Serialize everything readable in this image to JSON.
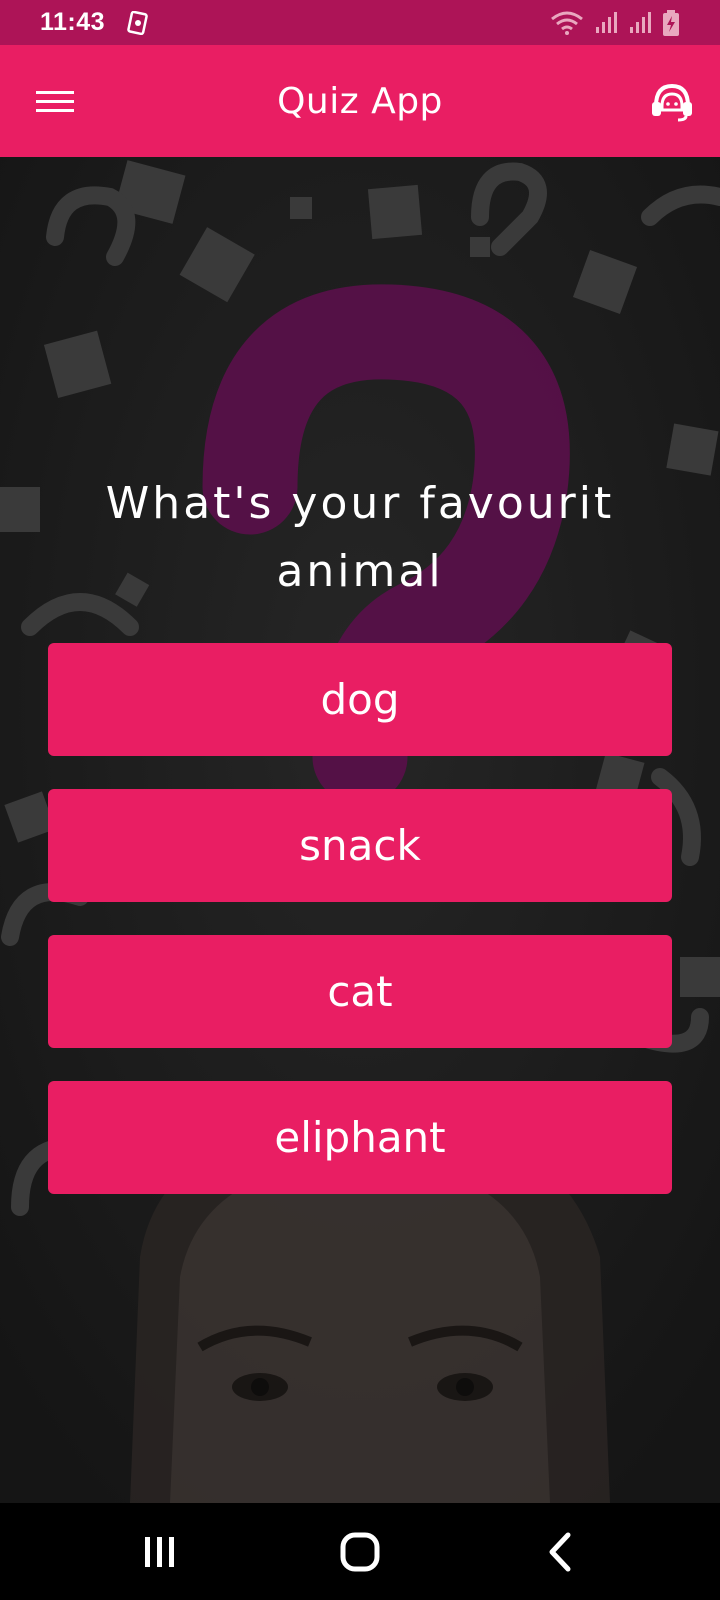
{
  "status_bar": {
    "time": "11:43"
  },
  "app_bar": {
    "title": "Quiz App"
  },
  "quiz": {
    "question": "What's your favourit animal",
    "answers": [
      "dog",
      "snack",
      "cat",
      "eliphant"
    ]
  },
  "colors": {
    "accent": "#e91e63",
    "status_bar": "#ad1457",
    "background": "#1b1b1b",
    "question_mark": "#5a0f4a"
  },
  "icons": {
    "menu": "hamburger-menu-icon",
    "support": "headset-support-icon",
    "nav_recents": "recents-icon",
    "nav_home": "home-icon",
    "nav_back": "back-icon"
  }
}
